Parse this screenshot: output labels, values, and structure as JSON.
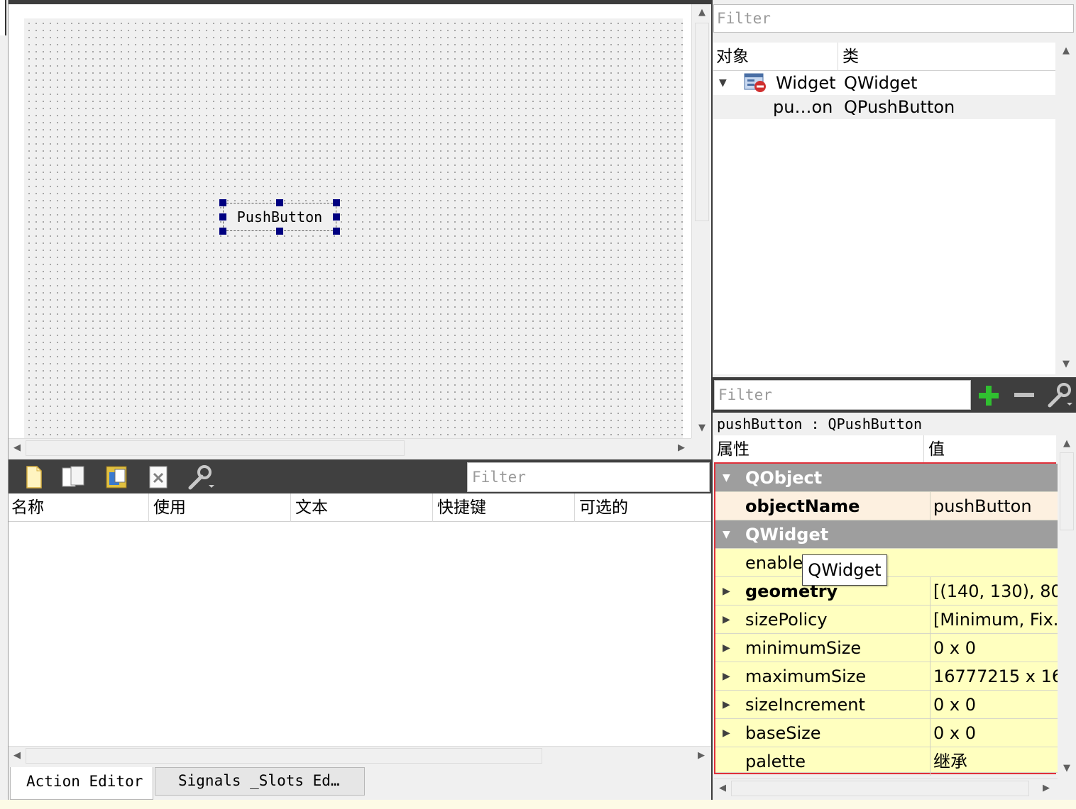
{
  "form": {
    "push_button_label": "PushButton"
  },
  "action_editor": {
    "filter_placeholder": "Filter",
    "columns": [
      "名称",
      "使用",
      "文本",
      "快捷键",
      "可选的"
    ],
    "tabs": [
      "Action Editor",
      "Signals _Slots Ed…"
    ]
  },
  "object_inspector": {
    "filter_placeholder": "Filter",
    "columns": [
      "对象",
      "类"
    ],
    "rows": [
      {
        "object": "Widget",
        "class": "QWidget"
      },
      {
        "object": "pu…on",
        "class": "QPushButton"
      }
    ]
  },
  "property_editor": {
    "filter_placeholder": "Filter",
    "current_object": "pushButton : QPushButton",
    "columns": [
      "属性",
      "值"
    ],
    "groups": [
      {
        "name": "QObject"
      },
      {
        "name": "QWidget"
      }
    ],
    "props": [
      {
        "name": "objectName",
        "value": "pushButton"
      },
      {
        "name": "enabled",
        "value": ""
      },
      {
        "name": "geometry",
        "value": "[(140, 130), 80..."
      },
      {
        "name": "sizePolicy",
        "value": "[Minimum, Fix..."
      },
      {
        "name": "minimumSize",
        "value": "0 x 0"
      },
      {
        "name": "maximumSize",
        "value": "16777215 x 16..."
      },
      {
        "name": "sizeIncrement",
        "value": "0 x 0"
      },
      {
        "name": "baseSize",
        "value": "0 x 0"
      },
      {
        "name": "palette",
        "value": "继承"
      }
    ],
    "tooltip": "QWidget"
  },
  "colors": {
    "group_header": "#9e9e9e",
    "row_highlight": "#ffffbf",
    "selection_border": "#e0303a",
    "handle": "#000080"
  }
}
